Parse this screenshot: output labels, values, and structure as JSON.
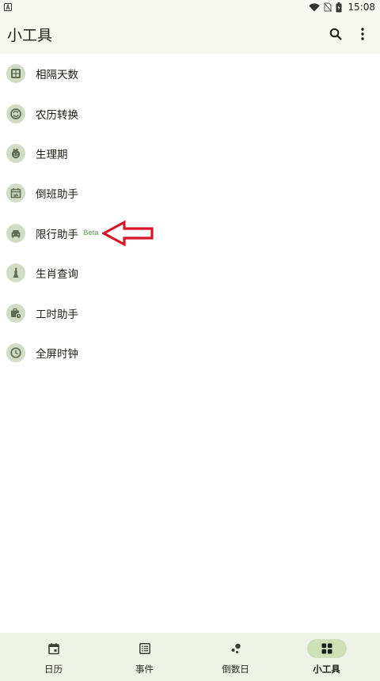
{
  "status_bar": {
    "time": "15:08",
    "left_icon": "a-notification-icon",
    "icons": [
      "wifi-icon",
      "no-sim-icon",
      "battery-charging-icon"
    ]
  },
  "app_bar": {
    "title": "小工具",
    "actions": [
      "search-icon",
      "more-vert-icon"
    ]
  },
  "tools": [
    {
      "label": "相隔天数",
      "icon": "grid-icon"
    },
    {
      "label": "农历转换",
      "icon": "sync-circle-icon"
    },
    {
      "label": "生理期",
      "icon": "flower-icon"
    },
    {
      "label": "倒班助手",
      "icon": "calendar-swap-icon"
    },
    {
      "label": "限行助手",
      "icon": "car-icon",
      "badge": "Beta"
    },
    {
      "label": "生肖查询",
      "icon": "zodiac-figure-icon"
    },
    {
      "label": "工时助手",
      "icon": "briefcase-clock-icon"
    },
    {
      "label": "全屏时钟",
      "icon": "clock-icon"
    }
  ],
  "bottom_nav": [
    {
      "label": "日历",
      "icon": "calendar-icon",
      "active": false
    },
    {
      "label": "事件",
      "icon": "list-icon",
      "active": false
    },
    {
      "label": "倒数日",
      "icon": "dots-icon",
      "active": false
    },
    {
      "label": "小工具",
      "icon": "widgets-icon",
      "active": true
    }
  ],
  "colors": {
    "background": "#ffffff",
    "app_bar": "#f6f8f1",
    "icon_circle": "#d2dbc4",
    "icon_glyph": "#5f6b52",
    "beta": "#55a04a",
    "annotation_arrow": "#d8162a",
    "bottom_nav": "#eef2e7",
    "nav_active_pill": "#cfe0b7"
  }
}
